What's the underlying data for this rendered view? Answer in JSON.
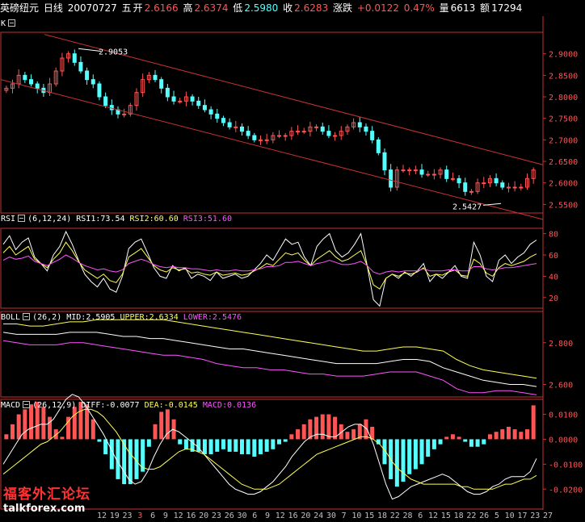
{
  "header": {
    "instrument": "英磅纽元",
    "period": "日线",
    "date": "20070727",
    "weekday": "五",
    "open_label": "开",
    "open": "2.6166",
    "high_label": "高",
    "high": "2.6374",
    "low_label": "低",
    "low": "2.5980",
    "close_label": "收",
    "close": "2.6283",
    "change_label": "涨跌",
    "change": "+0.0122",
    "change_pct": "0.47%",
    "volume_label": "量",
    "volume": "6613",
    "amount_label": "额",
    "amount": "17294"
  },
  "panels": {
    "k": {
      "label": "K"
    },
    "rsi": {
      "name": "RSI",
      "params": "(6,12,24)",
      "v1": "RSI1:73.54",
      "v2": "RSI2:60.60",
      "v3": "RSI3:51.60"
    },
    "boll": {
      "name": "BOLL",
      "params": "(26,2)",
      "v1": "MID:2.5905",
      "v2": "UPPER:2.6334",
      "v3": "LOWER:2.5476"
    },
    "macd": {
      "name": "MACD",
      "params": "(26,12,9)",
      "v1": "DIFF:-0.0077",
      "v2": "DEA:-0.0145",
      "v3": "MACD:0.0136"
    }
  },
  "watermark": {
    "cn": "福客外汇论坛",
    "en": "talkforex.com"
  },
  "colors": {
    "up": "#ff5555",
    "down": "#55ffff",
    "white": "#ffffff",
    "yellow": "#ffff55",
    "magenta": "#ff55ff",
    "frame": "#c83232"
  },
  "chart_data": [
    {
      "type": "candlestick",
      "title": "K",
      "ylim": [
        2.53,
        2.95
      ],
      "yticks": [
        "2.9000",
        "2.8500",
        "2.8000",
        "2.7500",
        "2.7000",
        "2.6500",
        "2.6000",
        "2.5500"
      ],
      "annotations": [
        "2.9053",
        "2.5427"
      ],
      "trend_channel": "descending",
      "close": [
        2.82,
        2.83,
        2.85,
        2.84,
        2.83,
        2.82,
        2.81,
        2.83,
        2.86,
        2.89,
        2.9,
        2.88,
        2.86,
        2.84,
        2.83,
        2.8,
        2.78,
        2.77,
        2.76,
        2.76,
        2.78,
        2.81,
        2.84,
        2.85,
        2.84,
        2.82,
        2.8,
        2.79,
        2.79,
        2.8,
        2.79,
        2.78,
        2.77,
        2.76,
        2.75,
        2.74,
        2.73,
        2.73,
        2.72,
        2.71,
        2.7,
        2.7,
        2.7,
        2.71,
        2.71,
        2.71,
        2.72,
        2.72,
        2.72,
        2.73,
        2.73,
        2.72,
        2.71,
        2.71,
        2.72,
        2.73,
        2.74,
        2.73,
        2.72,
        2.7,
        2.67,
        2.63,
        2.59,
        2.63,
        2.63,
        2.63,
        2.63,
        2.62,
        2.62,
        2.62,
        2.63,
        2.61,
        2.61,
        2.6,
        2.58,
        2.58,
        2.6,
        2.6,
        2.61,
        2.6,
        2.59,
        2.59,
        2.59,
        2.59,
        2.61,
        2.63
      ]
    },
    {
      "type": "line",
      "title": "RSI (6,12,24)",
      "ylim": [
        10,
        85
      ],
      "yticks": [
        "80",
        "60",
        "40",
        "20"
      ],
      "series": [
        {
          "name": "RSI1",
          "values": [
            70,
            78,
            65,
            72,
            76,
            58,
            52,
            45,
            60,
            68,
            82,
            70,
            55,
            42,
            35,
            30,
            38,
            28,
            25,
            40,
            66,
            72,
            75,
            62,
            48,
            40,
            38,
            50,
            45,
            48,
            38,
            42,
            40,
            36,
            44,
            38,
            40,
            42,
            38,
            40,
            46,
            52,
            60,
            55,
            65,
            75,
            70,
            72,
            58,
            50,
            68,
            75,
            80,
            64,
            58,
            62,
            70,
            80,
            50,
            18,
            12,
            38,
            42,
            38,
            44,
            40,
            45,
            52,
            35,
            42,
            38,
            44,
            50,
            40,
            38,
            72,
            60,
            40,
            35,
            55,
            60,
            52,
            58,
            62,
            70,
            74
          ]
        },
        {
          "name": "RSI2",
          "values": [
            62,
            68,
            60,
            64,
            68,
            56,
            52,
            48,
            56,
            62,
            72,
            64,
            54,
            46,
            42,
            38,
            42,
            36,
            34,
            42,
            58,
            62,
            66,
            58,
            50,
            46,
            44,
            48,
            46,
            47,
            43,
            44,
            42,
            41,
            44,
            41,
            42,
            43,
            41,
            42,
            45,
            48,
            52,
            50,
            56,
            62,
            60,
            62,
            55,
            50,
            56,
            60,
            64,
            58,
            54,
            56,
            60,
            64,
            50,
            32,
            28,
            38,
            42,
            40,
            43,
            42,
            44,
            48,
            40,
            42,
            41,
            44,
            46,
            41,
            40,
            56,
            52,
            43,
            40,
            48,
            52,
            50,
            52,
            54,
            58,
            61
          ]
        },
        {
          "name": "RSI3",
          "values": [
            55,
            58,
            56,
            57,
            59,
            54,
            52,
            50,
            53,
            56,
            60,
            57,
            53,
            50,
            48,
            46,
            47,
            45,
            44,
            46,
            52,
            54,
            56,
            54,
            51,
            49,
            48,
            49,
            48,
            48,
            47,
            47,
            46,
            45,
            46,
            45,
            45,
            46,
            45,
            45,
            46,
            47,
            49,
            49,
            50,
            53,
            53,
            54,
            52,
            50,
            52,
            53,
            55,
            53,
            51,
            51,
            52,
            54,
            50,
            44,
            42,
            44,
            45,
            44,
            45,
            45,
            45,
            47,
            45,
            45,
            45,
            46,
            46,
            45,
            45,
            49,
            49,
            47,
            46,
            47,
            48,
            48,
            49,
            50,
            51,
            52
          ]
        }
      ]
    },
    {
      "type": "line",
      "title": "BOLL (26,2)",
      "ylim": [
        2.54,
        2.95
      ],
      "yticks": [
        "2.800",
        "2.600"
      ],
      "series": [
        {
          "name": "UPPER",
          "values": [
            2.89,
            2.89,
            2.88,
            2.88,
            2.89,
            2.9,
            2.9,
            2.91,
            2.91,
            2.91,
            2.91,
            2.91,
            2.91,
            2.9,
            2.89,
            2.88,
            2.87,
            2.86,
            2.85,
            2.84,
            2.83,
            2.82,
            2.81,
            2.8,
            2.79,
            2.78,
            2.77,
            2.76,
            2.76,
            2.77,
            2.78,
            2.78,
            2.77,
            2.76,
            2.72,
            2.69,
            2.67,
            2.66,
            2.65,
            2.64,
            2.63
          ]
        },
        {
          "name": "MID",
          "values": [
            2.85,
            2.84,
            2.84,
            2.84,
            2.84,
            2.85,
            2.85,
            2.85,
            2.84,
            2.83,
            2.83,
            2.82,
            2.82,
            2.81,
            2.8,
            2.79,
            2.78,
            2.77,
            2.77,
            2.76,
            2.75,
            2.74,
            2.73,
            2.72,
            2.71,
            2.7,
            2.7,
            2.7,
            2.7,
            2.71,
            2.72,
            2.72,
            2.71,
            2.68,
            2.66,
            2.64,
            2.62,
            2.61,
            2.6,
            2.6,
            2.59
          ]
        },
        {
          "name": "LOWER",
          "values": [
            2.81,
            2.8,
            2.79,
            2.79,
            2.79,
            2.8,
            2.8,
            2.79,
            2.78,
            2.77,
            2.76,
            2.75,
            2.74,
            2.74,
            2.73,
            2.72,
            2.7,
            2.69,
            2.68,
            2.68,
            2.67,
            2.67,
            2.66,
            2.65,
            2.65,
            2.64,
            2.64,
            2.64,
            2.65,
            2.66,
            2.66,
            2.66,
            2.64,
            2.62,
            2.58,
            2.56,
            2.56,
            2.57,
            2.57,
            2.56,
            2.55
          ]
        }
      ]
    },
    {
      "type": "bar",
      "title": "MACD (26,12,9)",
      "ylim": [
        -0.028,
        0.016
      ],
      "yticks": [
        "0.0100",
        "0.0000",
        "-0.0100",
        "-0.0200"
      ],
      "x_tick_labels": [
        "12",
        "19",
        "23",
        "3",
        "6",
        "9",
        "12",
        "16",
        "20",
        "23",
        "26",
        "30",
        "6",
        "9",
        "12",
        "16",
        "20",
        "24",
        "30",
        "7",
        "10",
        "15",
        "18",
        "22",
        "28",
        "6",
        "12",
        "15",
        "18",
        "22",
        "26",
        "5",
        "10",
        "17",
        "23",
        "27"
      ],
      "macd": [
        0.002,
        0.006,
        0.01,
        0.012,
        0.014,
        0.015,
        0.013,
        0.009,
        0.004,
        0.001,
        0.009,
        0.013,
        0.015,
        0.014,
        0.008,
        -0.001,
        -0.006,
        -0.012,
        -0.016,
        -0.018,
        -0.018,
        -0.016,
        -0.013,
        -0.003,
        0.006,
        0.011,
        0.012,
        0.008,
        -0.002,
        -0.004,
        -0.005,
        -0.005,
        -0.006,
        -0.006,
        -0.005,
        -0.004,
        -0.005,
        -0.005,
        -0.006,
        -0.006,
        -0.007,
        -0.006,
        -0.005,
        -0.004,
        -0.002,
        -0.001,
        0.002,
        0.004,
        0.006,
        0.008,
        0.009,
        0.01,
        0.01,
        0.009,
        0.006,
        0.003,
        0.004,
        0.006,
        0.008,
        0.005,
        -0.002,
        -0.01,
        -0.016,
        -0.019,
        -0.017,
        -0.014,
        -0.012,
        -0.01,
        -0.007,
        -0.004,
        -0.002,
        0.001,
        0.002,
        0.001,
        -0.001,
        -0.003,
        -0.003,
        -0.002,
        0.002,
        0.003,
        0.004,
        0.005,
        0.004,
        0.003,
        0.004,
        0.0136
      ],
      "diff": [
        -0.01,
        -0.006,
        -0.002,
        0.002,
        0.004,
        0.005,
        0.006,
        0.006,
        0.008,
        0.012,
        0.016,
        0.018,
        0.017,
        0.014,
        0.01,
        0.006,
        0.002,
        -0.003,
        -0.008,
        -0.012,
        -0.016,
        -0.018,
        -0.017,
        -0.013,
        -0.007,
        -0.002,
        0.002,
        0.004,
        0.003,
        0.001,
        -0.001,
        -0.003,
        -0.006,
        -0.009,
        -0.012,
        -0.015,
        -0.018,
        -0.02,
        -0.021,
        -0.022,
        -0.022,
        -0.021,
        -0.019,
        -0.017,
        -0.014,
        -0.011,
        -0.007,
        -0.004,
        -0.001,
        0.001,
        0.002,
        0.002,
        0.001,
        0.001,
        0.003,
        0.005,
        0.006,
        0.006,
        0.004,
        -0.002,
        -0.01,
        -0.018,
        -0.024,
        -0.023,
        -0.021,
        -0.019,
        -0.018,
        -0.017,
        -0.016,
        -0.015,
        -0.014,
        -0.015,
        -0.017,
        -0.019,
        -0.021,
        -0.022,
        -0.022,
        -0.021,
        -0.019,
        -0.018,
        -0.016,
        -0.015,
        -0.015,
        -0.015,
        -0.013,
        -0.0077
      ],
      "dea": [
        -0.014,
        -0.012,
        -0.01,
        -0.008,
        -0.006,
        -0.004,
        -0.002,
        -0.001,
        0.001,
        0.003,
        0.006,
        0.009,
        0.011,
        0.012,
        0.012,
        0.011,
        0.009,
        0.006,
        0.003,
        -0.001,
        -0.005,
        -0.008,
        -0.011,
        -0.012,
        -0.012,
        -0.011,
        -0.009,
        -0.007,
        -0.005,
        -0.004,
        -0.004,
        -0.005,
        -0.006,
        -0.008,
        -0.01,
        -0.012,
        -0.014,
        -0.016,
        -0.018,
        -0.019,
        -0.02,
        -0.02,
        -0.02,
        -0.019,
        -0.018,
        -0.016,
        -0.014,
        -0.012,
        -0.01,
        -0.008,
        -0.006,
        -0.005,
        -0.004,
        -0.003,
        -0.002,
        -0.001,
        0.0,
        0.001,
        0.001,
        0.0,
        -0.002,
        -0.005,
        -0.009,
        -0.012,
        -0.014,
        -0.016,
        -0.017,
        -0.018,
        -0.018,
        -0.018,
        -0.018,
        -0.018,
        -0.018,
        -0.019,
        -0.019,
        -0.02,
        -0.02,
        -0.02,
        -0.02,
        -0.019,
        -0.018,
        -0.018,
        -0.017,
        -0.016,
        -0.016,
        -0.0145
      ]
    }
  ]
}
